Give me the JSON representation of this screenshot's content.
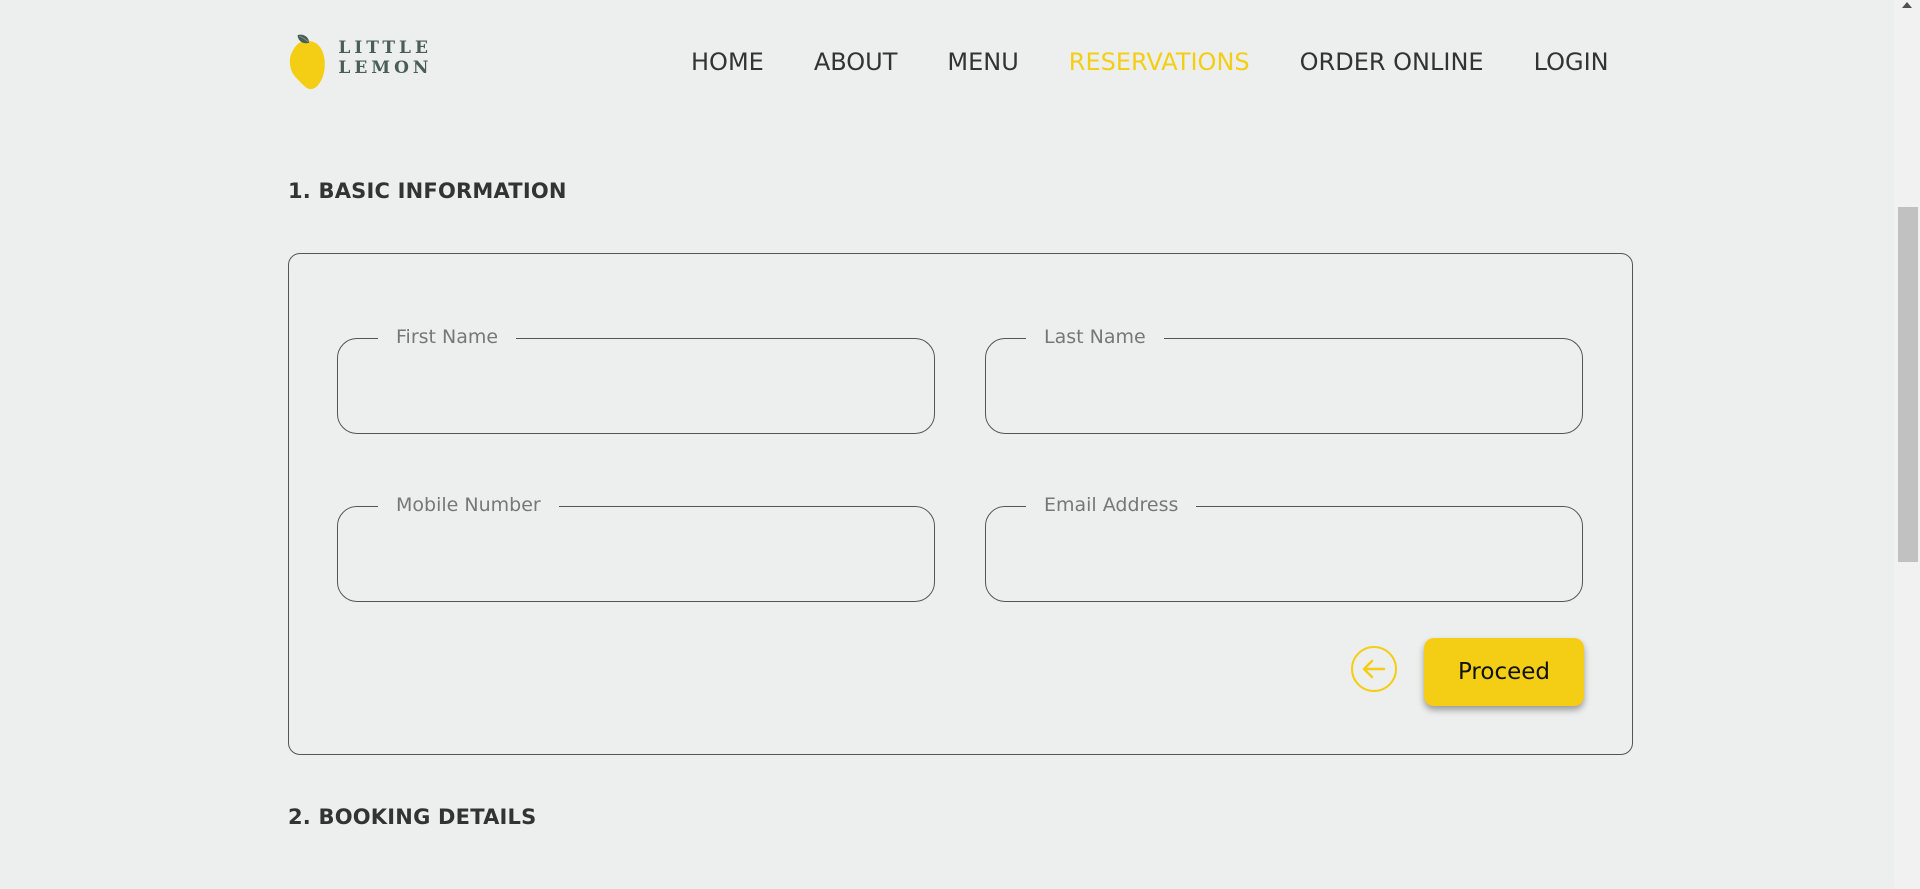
{
  "header": {
    "logo_text": "LITTLE LEMON",
    "nav": [
      {
        "label": "HOME",
        "active": false
      },
      {
        "label": "ABOUT",
        "active": false
      },
      {
        "label": "MENU",
        "active": false
      },
      {
        "label": "RESERVATIONS",
        "active": true
      },
      {
        "label": "ORDER ONLINE",
        "active": false
      },
      {
        "label": "LOGIN",
        "active": false
      }
    ]
  },
  "sections": {
    "basic_info_title": "1. BASIC INFORMATION",
    "booking_details_title": "2. BOOKING DETAILS"
  },
  "form": {
    "first_name": {
      "label": "First Name",
      "value": ""
    },
    "last_name": {
      "label": "Last Name",
      "value": ""
    },
    "mobile_number": {
      "label": "Mobile Number",
      "value": ""
    },
    "email_address": {
      "label": "Email Address",
      "value": ""
    },
    "back_icon": "arrow-left-circle-icon",
    "proceed_label": "Proceed"
  },
  "colors": {
    "accent": "#f4ce14",
    "background": "#edefee",
    "text": "#333333",
    "logo_green": "#495e57"
  }
}
